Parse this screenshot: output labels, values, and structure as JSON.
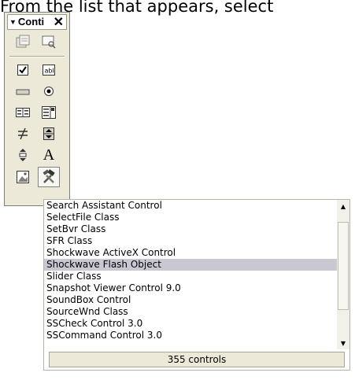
{
  "instruction_text": "From the list that appears, select",
  "toolbox": {
    "title": "Conti",
    "close_glyph": "✕",
    "tools": [
      {
        "name": "properties-icon"
      },
      {
        "name": "view-code-icon"
      },
      {
        "name": "checkbox-icon"
      },
      {
        "name": "textbox-icon"
      },
      {
        "name": "button-icon"
      },
      {
        "name": "radio-button-icon"
      },
      {
        "name": "listbox-icon"
      },
      {
        "name": "combobox-icon"
      },
      {
        "name": "toggle-button-icon"
      },
      {
        "name": "spin-button-icon"
      },
      {
        "name": "scrollbar-icon"
      },
      {
        "name": "label-icon"
      },
      {
        "name": "image-icon"
      },
      {
        "name": "more-controls-icon"
      }
    ]
  },
  "list": {
    "items": [
      "Search Assistant Control",
      "SelectFile Class",
      "SetBvr Class",
      "SFR Class",
      "Shockwave ActiveX Control",
      "Shockwave Flash Object",
      "Slider Class",
      "Snapshot Viewer Control 9.0",
      "SoundBox Control",
      "SourceWnd Class",
      "SSCheck Control 3.0",
      "SSCommand Control 3.0"
    ],
    "selected_index": 5,
    "status": "355 controls",
    "scroll_up_glyph": "▲",
    "scroll_down_glyph": "▼"
  }
}
